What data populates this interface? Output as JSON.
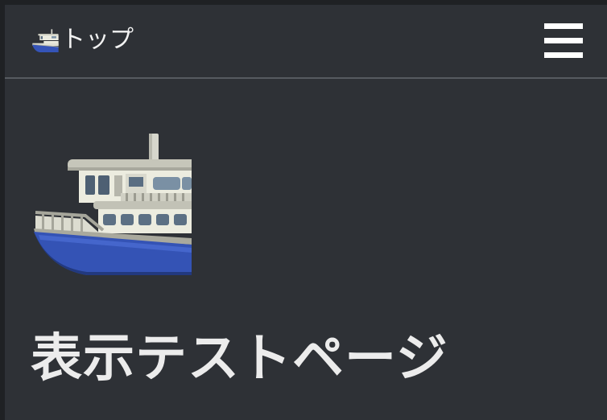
{
  "navbar": {
    "brand_icon": "ferry-icon",
    "brand_label": "トップ",
    "menu_icon": "hamburger-menu-icon"
  },
  "main": {
    "hero_icon": "ferry-icon",
    "title": "表示テストページ"
  },
  "colors": {
    "page_background": "#2e3136",
    "outer_border": "#1f2124",
    "divider": "#565a60",
    "text": "#ececec",
    "ferry_hull": "#3554b8",
    "ferry_cabin": "#e6e6da"
  }
}
